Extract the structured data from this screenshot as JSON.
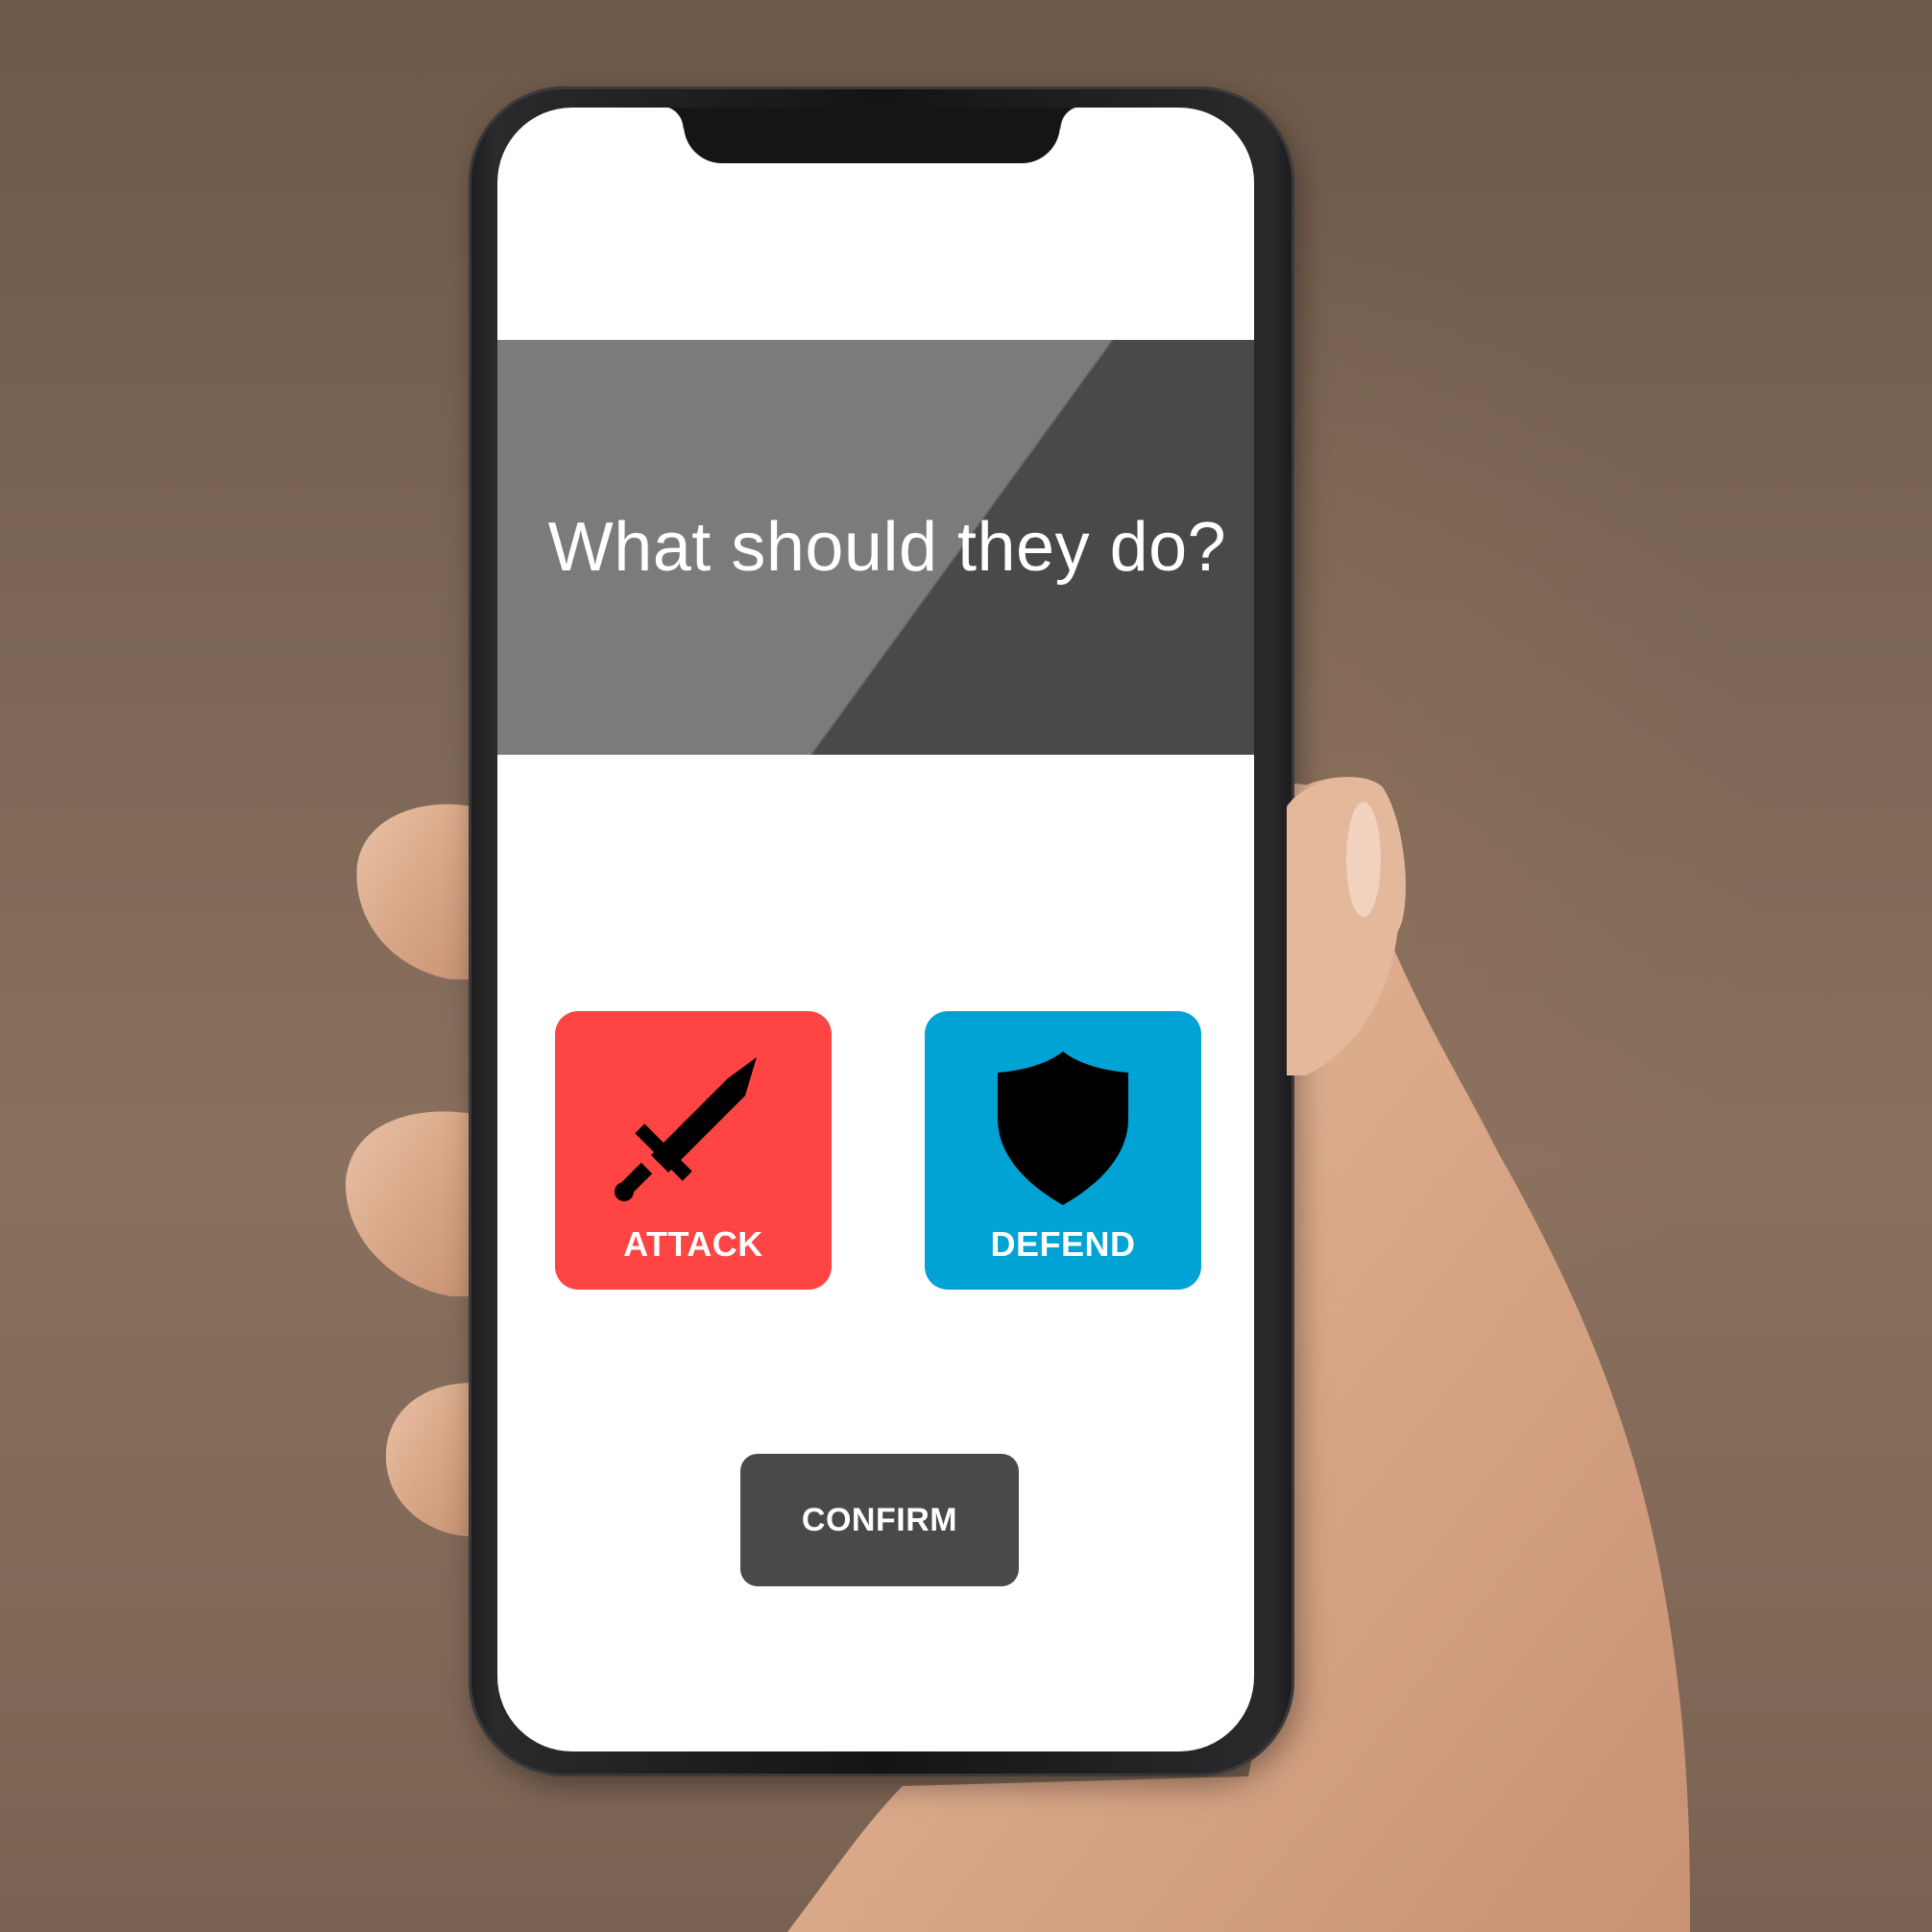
{
  "screen": {
    "question": "What should they do?",
    "banner_color": "#7b7b7b",
    "banner_shade_color": "#4a494a"
  },
  "actions": [
    {
      "label": "ATTACK",
      "icon": "sword-icon",
      "color": "#ff4444"
    },
    {
      "label": "DEFEND",
      "icon": "shield-icon",
      "color": "#00a3d4"
    }
  ],
  "confirm": {
    "label": "CONFIRM",
    "color": "#4a494a"
  }
}
